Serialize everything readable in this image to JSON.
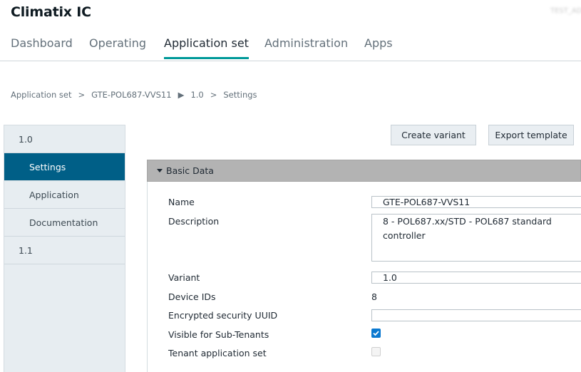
{
  "app": {
    "title": "Climatix IC",
    "user": "TEST_ADMIN"
  },
  "nav": {
    "tabs": [
      {
        "label": "Dashboard"
      },
      {
        "label": "Operating"
      },
      {
        "label": "Application set"
      },
      {
        "label": "Administration"
      },
      {
        "label": "Apps"
      }
    ],
    "active": "Application set"
  },
  "breadcrumb": {
    "items": [
      "Application set",
      "GTE-POL687-VVS11",
      "1.0",
      "Settings"
    ],
    "separators": [
      ">",
      "▶",
      ">"
    ]
  },
  "sidebar": {
    "items": [
      {
        "label": "1.0"
      },
      {
        "label": "Settings"
      },
      {
        "label": "Application"
      },
      {
        "label": "Documentation"
      },
      {
        "label": "1.1"
      }
    ],
    "active": "Settings"
  },
  "toolbar": {
    "create_variant": "Create variant",
    "export_template": "Export template"
  },
  "basic_data": {
    "header": "Basic Data",
    "name_label": "Name",
    "name_value": "GTE-POL687-VVS11",
    "description_label": "Description",
    "description_value": "8 - POL687.xx/STD - POL687 standard controller",
    "variant_label": "Variant",
    "variant_value": "1.0",
    "device_ids_label": "Device IDs",
    "device_ids_value": "8",
    "uuid_label": "Encrypted security UUID",
    "uuid_value": "",
    "visible_label": "Visible for Sub-Tenants",
    "visible_checked": true,
    "tenant_label": "Tenant application set",
    "tenant_checked": false
  },
  "colors": {
    "accent": "#009999",
    "sidebar_active": "#005f87",
    "checkbox": "#0b79d0",
    "panel_header": "#b3b3b3"
  }
}
